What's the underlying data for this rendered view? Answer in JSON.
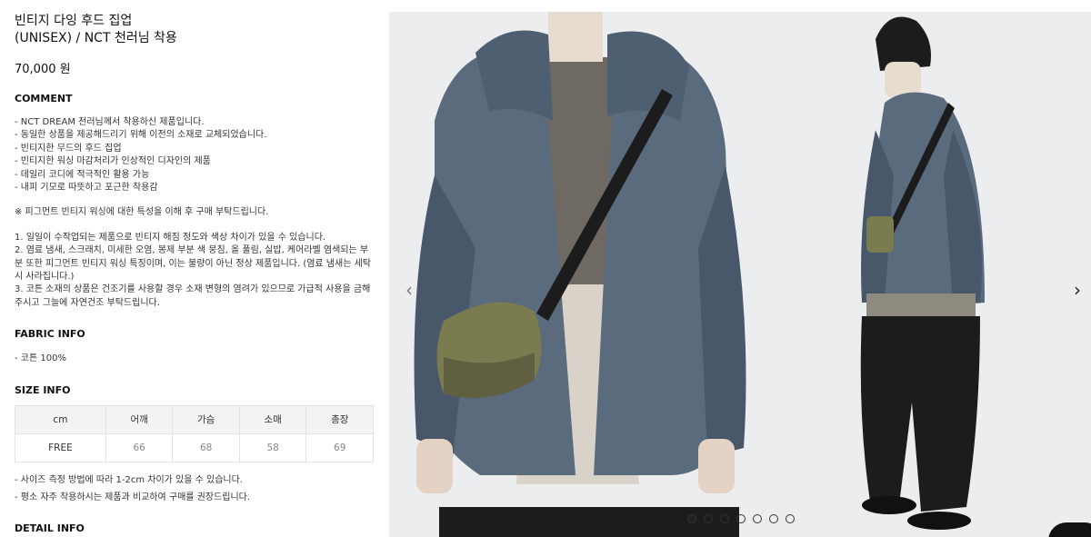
{
  "product": {
    "title": "빈티지 다잉 후드 집업",
    "subtitle": "(UNISEX) / NCT 천러님 착용",
    "price": "70,000 원"
  },
  "comment": {
    "heading": "COMMENT",
    "lines": [
      "- NCT DREAM 천러님께서 착용하신 제품입니다.",
      "- 동일한 상품을 제공해드리기 위해 이전의 소재로 교체되었습니다.",
      "- 빈티지한 무드의 후드 집업",
      "- 빈티지한 워싱 마감처리가 인상적인 디자인의 제품",
      "- 데일리 코디에 적극적인 활용 가능",
      "- 내피 기모로 따뜻하고 포근한 착용감"
    ],
    "notice": "※ 피그먼트 빈티지 워싱에 대한 특성을 이해 후 구매 부탁드립니다.",
    "notes": [
      "1. 일일이 수작업되는 제품으로 빈티지 해짐 정도와 색상 차이가 있을 수 있습니다.",
      "2. 염료 냄새, 스크래치, 미세한 오염, 봉제 부분 색 뭉침, 올 풀림, 실밥, 케어라벨 염색되는 부분 또한 피그먼트 빈티지 워싱 특징이며, 이는 불량이 아닌 정상 제품입니다. (염료 냄새는 세탁 시 사라집니다.)",
      "3. 코튼 소재의 상품은 건조기를 사용할 경우 소재 변형의 염려가 있으므로 가급적 사용을 금해주시고 그늘에 자연건조 부탁드립니다."
    ]
  },
  "fabric": {
    "heading": "FABRIC INFO",
    "line": "- 코튼 100%"
  },
  "size": {
    "heading": "SIZE INFO",
    "columns": [
      "cm",
      "어깨",
      "가슴",
      "소매",
      "총장"
    ],
    "row": [
      "FREE",
      "66",
      "68",
      "58",
      "69"
    ],
    "notes": [
      "- 사이즈 측정 방법에 따라 1-2cm 차이가 있을 수 있습니다.",
      "- 평소 자주 착용하시는 제품과 비교하여 구매를 권장드립니다."
    ],
    "next_heading_partial": "DETAIL INFO"
  },
  "gallery": {
    "prev_icon": "chevron-left-icon",
    "next_icon": "chevron-right-icon",
    "prev_glyph": "‹",
    "next_glyph": "›",
    "slide_count": 7,
    "active_index": 0
  },
  "colors": {
    "hoodie": "#5a6b7d",
    "hoodie_dark": "#48586a",
    "bag": "#7a7b4e",
    "background": "#ecedef",
    "beanie": "#1c1c1c"
  }
}
